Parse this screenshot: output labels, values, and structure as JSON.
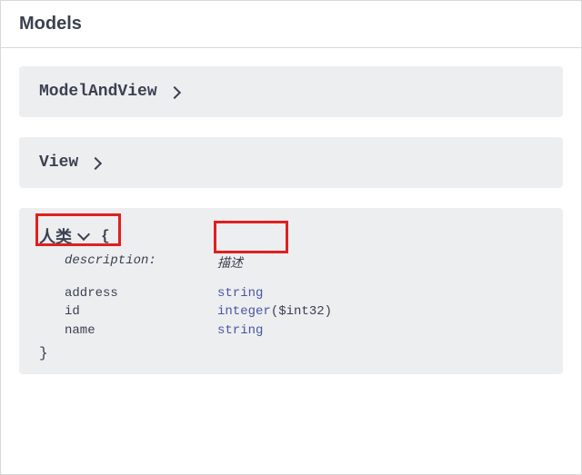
{
  "header": {
    "title": "Models"
  },
  "models": {
    "item0": {
      "name": "ModelAndView"
    },
    "item1": {
      "name": "View"
    },
    "item2": {
      "name": "人类",
      "open_brace": "{",
      "close_brace": "}",
      "desc_key": "description:",
      "desc_val": "描述",
      "props": {
        "p0": {
          "name": "address",
          "type": "string",
          "format": ""
        },
        "p1": {
          "name": "id",
          "type": "integer",
          "format": "($int32)"
        },
        "p2": {
          "name": "name",
          "type": "string",
          "format": ""
        }
      }
    }
  }
}
